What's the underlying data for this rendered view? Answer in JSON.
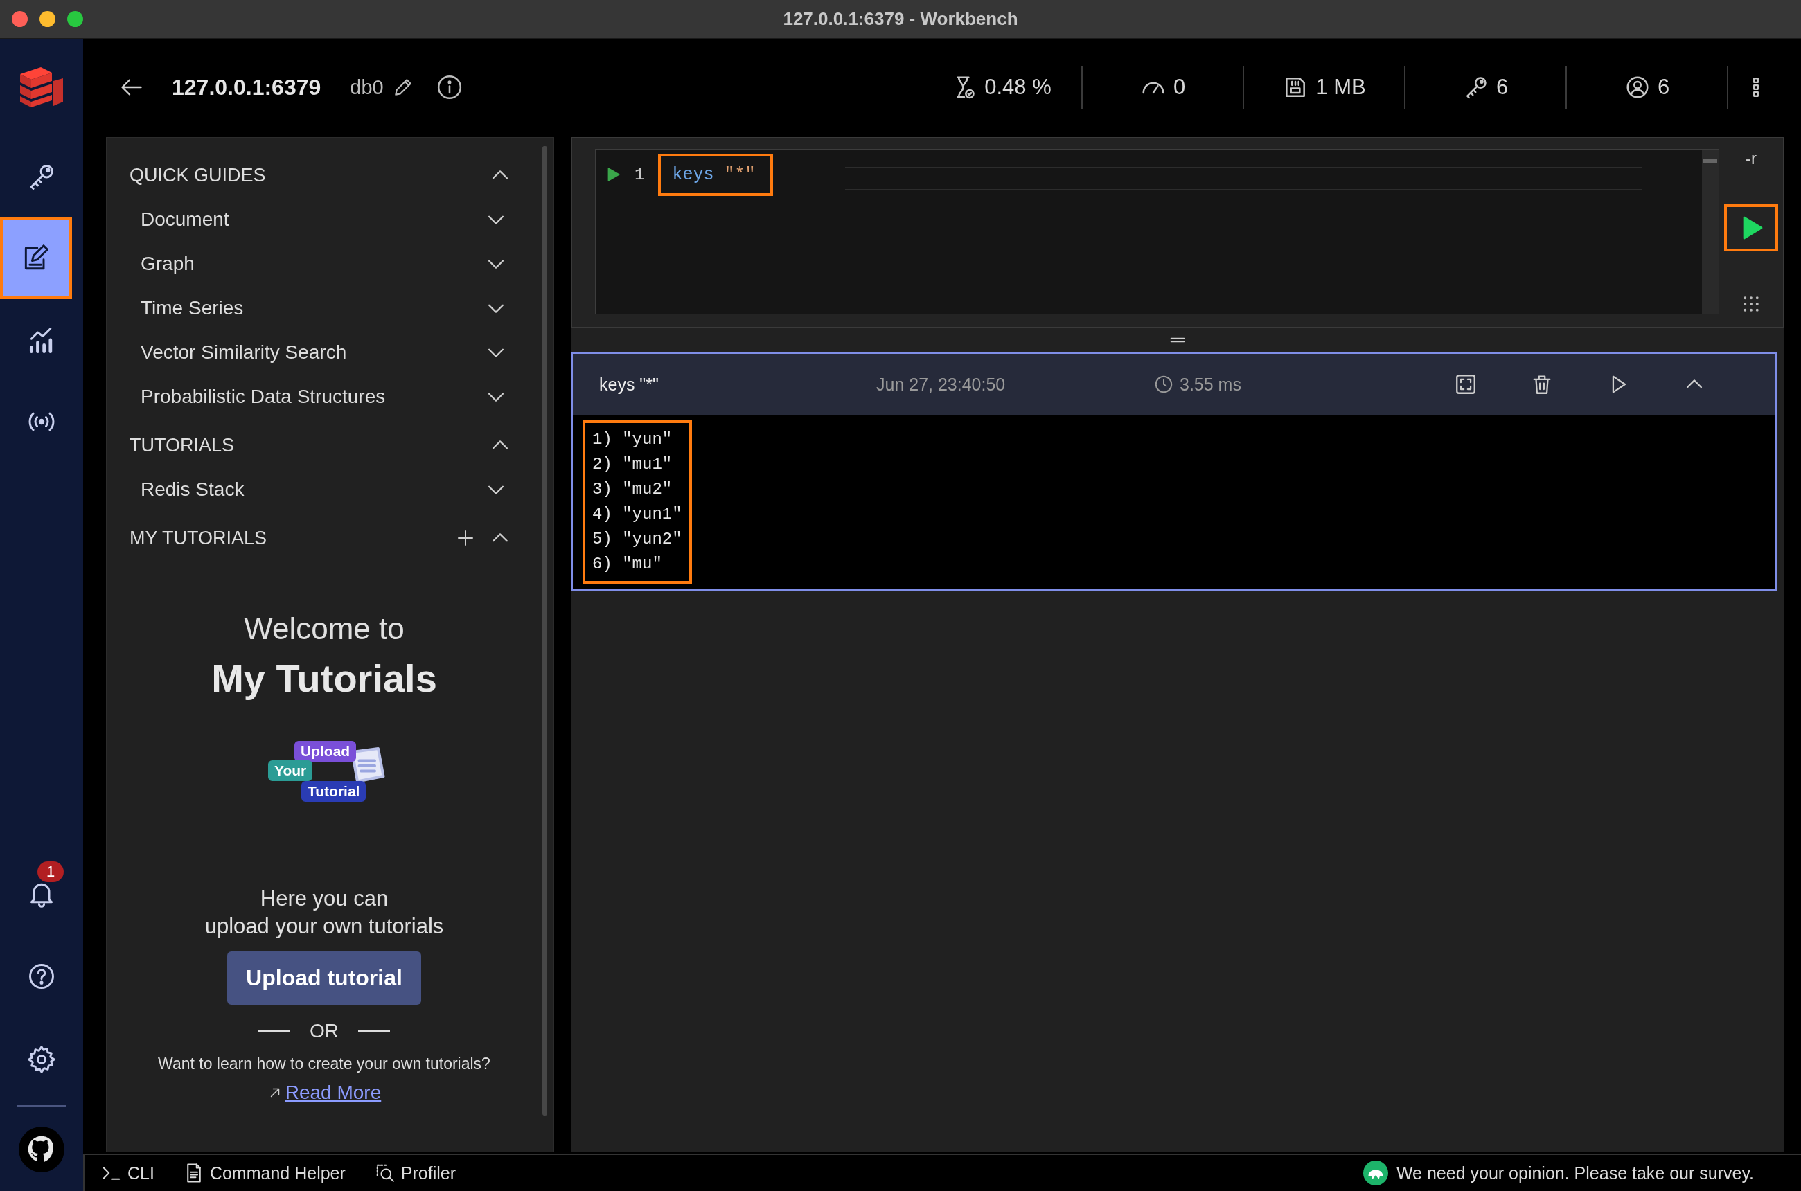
{
  "window": {
    "title": "127.0.0.1:6379 - Workbench"
  },
  "nav": {
    "top": [
      {
        "kind": "key",
        "selected": false,
        "highlighted": false
      },
      {
        "kind": "workbench",
        "selected": true,
        "highlighted": true
      },
      {
        "kind": "analytics",
        "selected": false,
        "highlighted": false
      },
      {
        "kind": "pubsub",
        "selected": false,
        "highlighted": false
      }
    ],
    "bottom": [
      {
        "kind": "bell",
        "badge": "1"
      },
      {
        "kind": "help"
      },
      {
        "kind": "settings"
      },
      {
        "kind": "github"
      }
    ]
  },
  "header": {
    "host": "127.0.0.1:6379",
    "db": "db0",
    "stats": [
      {
        "kind": "cpu",
        "value": "0.48 %"
      },
      {
        "kind": "ops",
        "value": "0"
      },
      {
        "kind": "memory",
        "value": "1 MB"
      },
      {
        "kind": "keys",
        "value": "6"
      },
      {
        "kind": "clients",
        "value": "6"
      }
    ]
  },
  "guides": {
    "sections": [
      {
        "title": "QUICK GUIDES",
        "expanded": true,
        "addable": false,
        "items": [
          {
            "label": "Document",
            "expanded": false
          },
          {
            "label": "Graph",
            "expanded": false
          },
          {
            "label": "Time Series",
            "expanded": false
          },
          {
            "label": "Vector Similarity Search",
            "expanded": false
          },
          {
            "label": "Probabilistic Data Structures",
            "expanded": false
          }
        ]
      },
      {
        "title": "TUTORIALS",
        "expanded": true,
        "addable": false,
        "items": [
          {
            "label": "Redis Stack",
            "expanded": false
          }
        ]
      },
      {
        "title": "MY TUTORIALS",
        "expanded": true,
        "addable": true
      }
    ]
  },
  "welcome": {
    "intro": "Welcome to",
    "title": "My Tutorials",
    "illustration": [
      "Upload",
      "Your",
      "Tutorial"
    ],
    "text_lines": [
      "Here you can",
      "upload your own tutorials"
    ],
    "button": "Upload tutorial",
    "divider": "OR",
    "question": "Want to learn how to create your own tutorials?",
    "link": "Read More"
  },
  "editor": {
    "lines": [
      {
        "number": "1",
        "command": "keys",
        "argument": "\"*\"",
        "highlighted": true
      }
    ],
    "flag": "-r",
    "run_highlighted": true
  },
  "result": {
    "command": "keys \"*\"",
    "time": "Jun 27, 23:40:50",
    "duration": "3.55 ms",
    "expanded": true,
    "output_highlighted": true,
    "output": [
      "1) \"yun\"",
      "2) \"mu1\"",
      "3) \"mu2\"",
      "4) \"yun1\"",
      "5) \"yun2\"",
      "6) \"mu\""
    ]
  },
  "bottom_bar": {
    "tools": [
      {
        "kind": "cli",
        "label": "CLI"
      },
      {
        "kind": "helper",
        "label": "Command Helper"
      },
      {
        "kind": "profiler",
        "label": "Profiler"
      }
    ],
    "survey": "We need your opinion. Please take our survey."
  }
}
